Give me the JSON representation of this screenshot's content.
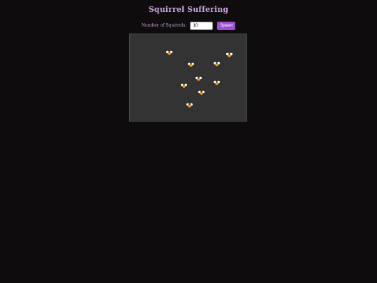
{
  "header": {
    "title": "Squirrel Suffering"
  },
  "controls": {
    "count_label": "Number of Squirrels:",
    "count_value": "10",
    "spawn_label": "Spawn"
  },
  "arena": {
    "background": "#333333",
    "squirrel_count": 10,
    "squirrel_icon": "squirrel-icon",
    "squirrel_colors": {
      "wing": "#ffffff",
      "body": "#f0a020",
      "head": "#222222"
    }
  },
  "colors": {
    "page_background": "#0e0c0c",
    "accent_text": "#c9a3e0",
    "button": "#9b4fd1"
  }
}
